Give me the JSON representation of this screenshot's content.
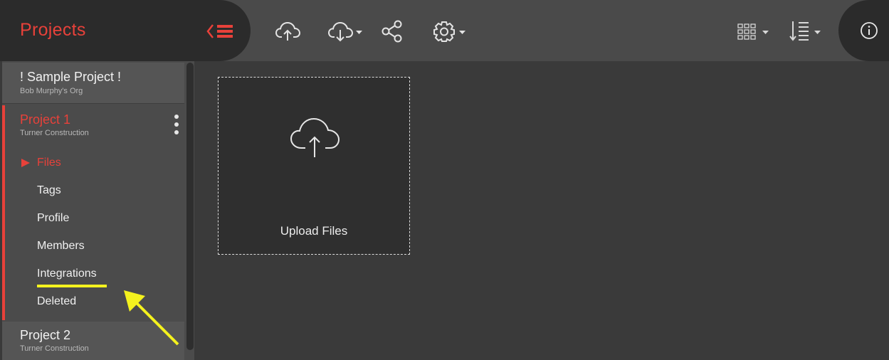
{
  "header": {
    "title": "Projects",
    "collapse_icon": "collapse-menu-icon",
    "toolbar": [
      {
        "name": "upload-button",
        "icon": "cloud-upload-icon"
      },
      {
        "name": "download-button",
        "icon": "cloud-download-icon"
      },
      {
        "name": "share-button",
        "icon": "share-icon"
      },
      {
        "name": "settings-button",
        "icon": "gear-icon"
      },
      {
        "name": "view-mode-button",
        "icon": "grid-view-icon"
      },
      {
        "name": "sort-button",
        "icon": "sort-icon"
      },
      {
        "name": "info-button",
        "icon": "info-icon"
      }
    ]
  },
  "sidebar": {
    "projects": [
      {
        "name": "! Sample Project !",
        "org": "Bob Murphy's Org"
      },
      {
        "name": "Project 1",
        "org": "Turner Construction"
      },
      {
        "name": "Project 2",
        "org": "Turner Construction"
      }
    ],
    "submenu": [
      {
        "label": "Files"
      },
      {
        "label": "Tags"
      },
      {
        "label": "Profile"
      },
      {
        "label": "Members"
      },
      {
        "label": "Integrations"
      },
      {
        "label": "Deleted"
      }
    ]
  },
  "main": {
    "upload_label": "Upload Files"
  },
  "colors": {
    "accent": "#e8413a",
    "annotation": "#f4f21e"
  }
}
